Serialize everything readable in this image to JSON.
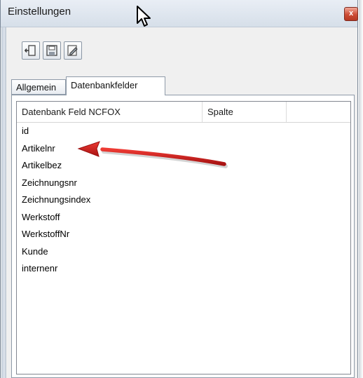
{
  "window": {
    "title": "Einstellungen",
    "close_glyph": "x"
  },
  "toolbar": {
    "buttons": [
      {
        "icon": "exit-door-icon"
      },
      {
        "icon": "save-disk-icon"
      },
      {
        "icon": "edit-document-icon"
      }
    ]
  },
  "tabs": [
    {
      "label": "Allgemein",
      "active": false
    },
    {
      "label": "Datenbankfelder",
      "active": true
    }
  ],
  "table": {
    "columns": [
      "Datenbank Feld NCFOX",
      "Spalte",
      ""
    ],
    "rows": [
      "id",
      "Artikelnr",
      "Artikelbez",
      "Zeichnungsnr",
      "Zeichnungsindex",
      "Werkstoff",
      "WerkstoffNr",
      "Kunde",
      "internenr"
    ]
  },
  "annotation": {
    "arrow_color": "#d61c1c",
    "points_to": "Artikelnr"
  },
  "colors": {
    "close_button": "#c9452f",
    "titlebar": "#dde5ee"
  }
}
